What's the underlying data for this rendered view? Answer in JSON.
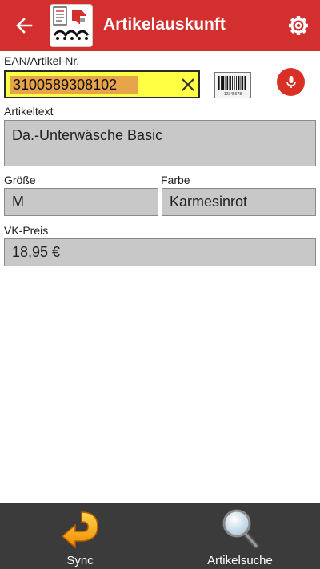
{
  "appbar": {
    "title": "Artikelauskunft",
    "back_icon": "arrow-left-icon",
    "settings_icon": "gear-icon",
    "bg_color": "#d32f2f"
  },
  "ean": {
    "label": "EAN/Artikel-Nr.",
    "value": "3100589308102",
    "clear_icon": "close-icon",
    "scan_icon": "barcode-icon",
    "barcode_caption": "12345678",
    "voice_icon": "microphone-icon"
  },
  "article_text": {
    "label": "Artikeltext",
    "value": "Da.-Unterwäsche Basic"
  },
  "size": {
    "label": "Größe",
    "value": "M"
  },
  "color": {
    "label": "Farbe",
    "value": "Karmesinrot"
  },
  "price": {
    "label": "VK-Preis",
    "value": "18,95 €"
  },
  "bottom_nav": {
    "sync": {
      "label": "Sync",
      "icon": "sync-arrow-icon"
    },
    "search": {
      "label": "Artikelsuche",
      "icon": "magnifier-icon"
    }
  }
}
